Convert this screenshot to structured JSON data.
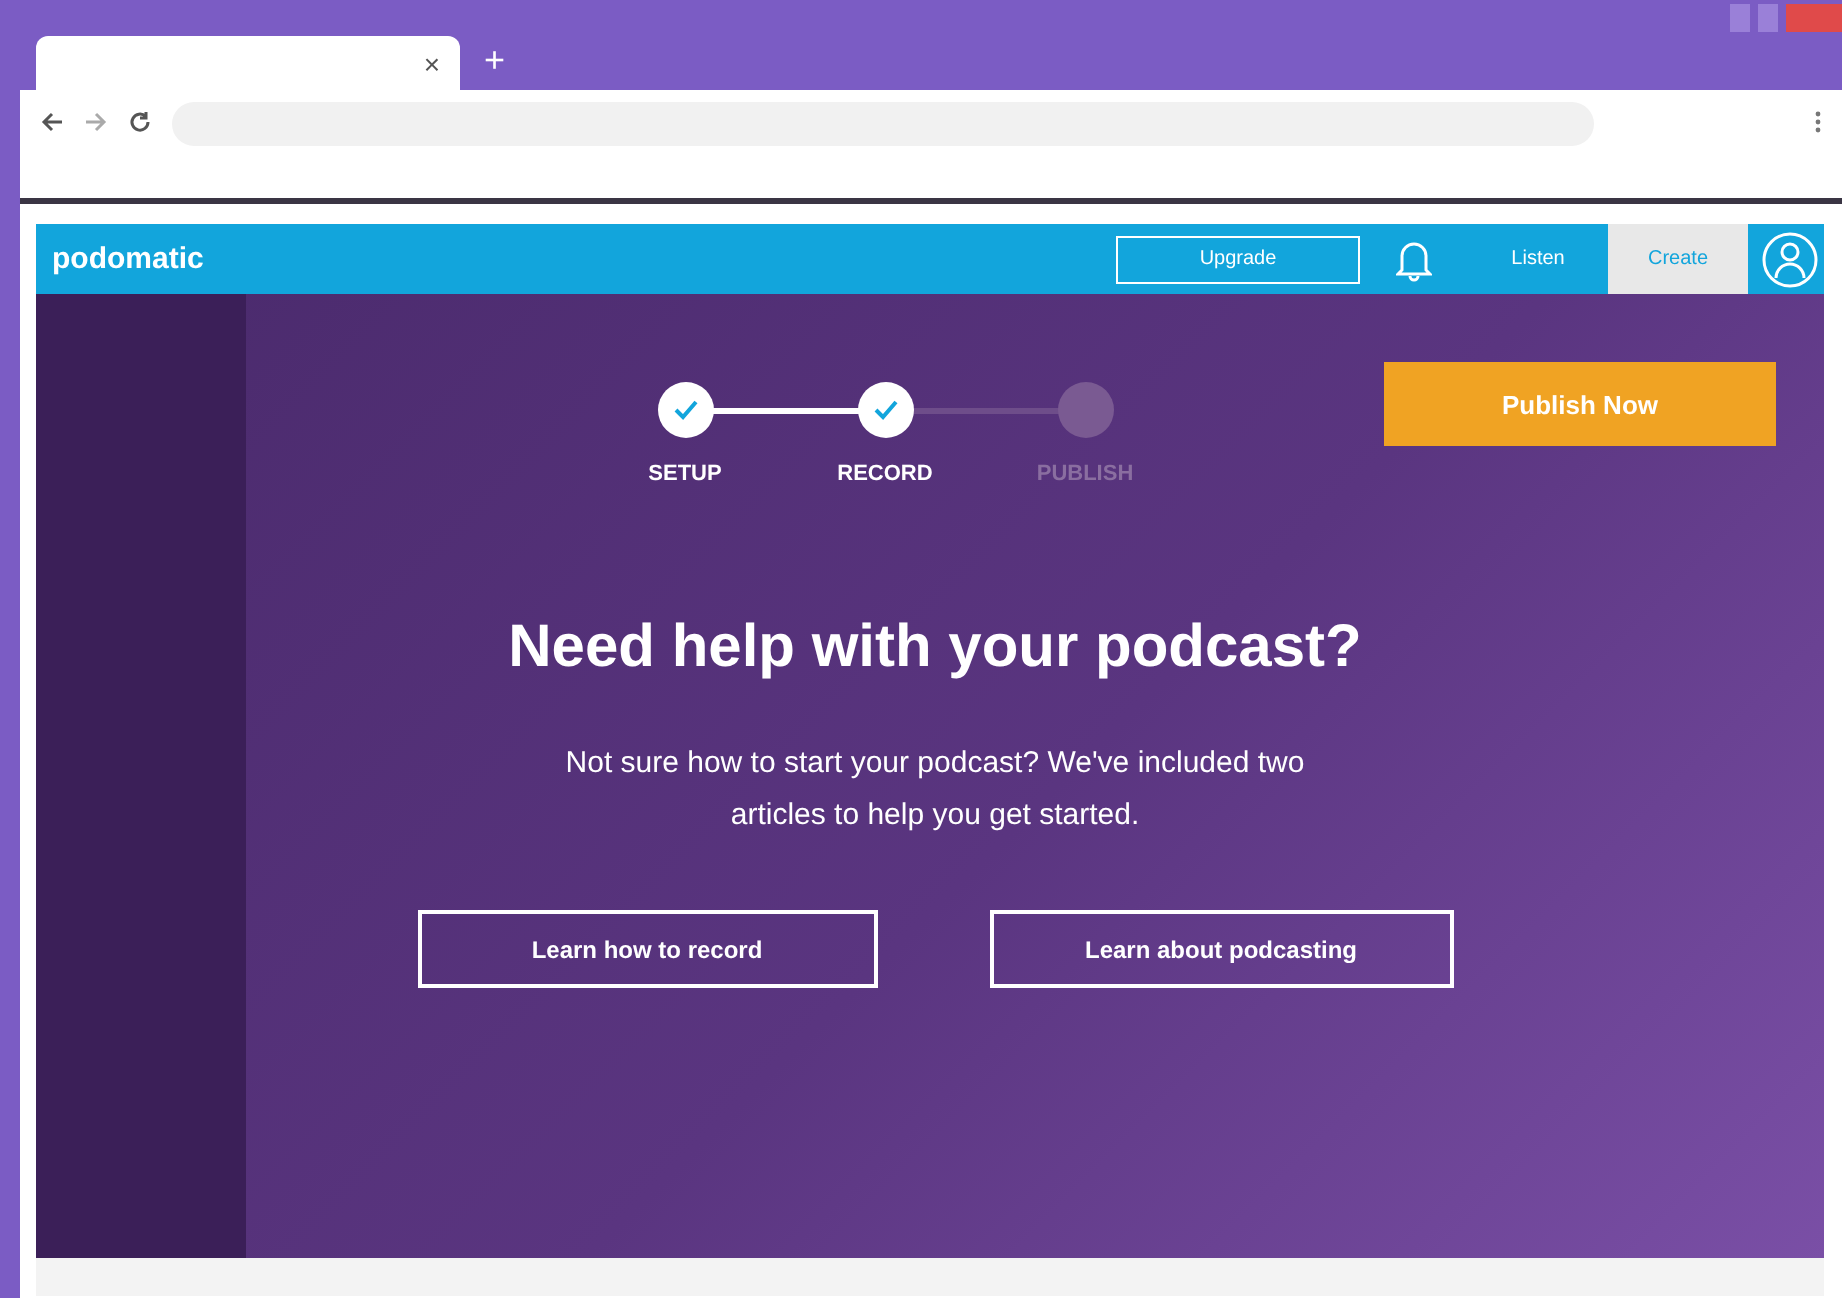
{
  "browser": {
    "tab_close": "×",
    "new_tab": "+"
  },
  "nav": {
    "logo": "podomatic",
    "upgrade": "Upgrade",
    "items": [
      {
        "label": "Listen",
        "selected": false
      },
      {
        "label": "Create",
        "selected": true
      }
    ]
  },
  "steps": [
    {
      "label": "SETUP",
      "done": true
    },
    {
      "label": "RECORD",
      "done": true
    },
    {
      "label": "PUBLISH",
      "done": false
    }
  ],
  "publish_button": "Publish Now",
  "heading": "Need help with your podcast?",
  "intro": "Not sure how to start your podcast? We've included two articles to help you get started.",
  "buttons": [
    "Learn how to record",
    "Learn about podcasting"
  ]
}
